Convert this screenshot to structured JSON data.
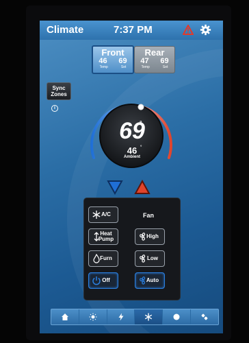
{
  "header": {
    "title": "Climate",
    "time": "7:37 PM"
  },
  "zones": [
    {
      "name": "Front",
      "temp": "46",
      "set": "69",
      "temp_label": "Temp",
      "set_label": "Set"
    },
    {
      "name": "Rear",
      "temp": "47",
      "set": "69",
      "temp_label": "Temp",
      "set_label": "Set"
    }
  ],
  "sync": {
    "line1": "Sync",
    "line2": "Zones"
  },
  "dial": {
    "setpoint": "69",
    "ambient": "46",
    "ambient_label": "Ambient"
  },
  "controls": {
    "ac": "A/C",
    "heat_pump": "Heat Pump",
    "furn": "Furn",
    "off": "Off",
    "fan_title": "Fan",
    "high": "High",
    "low": "Low",
    "auto": "Auto"
  },
  "nav": [
    "home-icon",
    "lights-icon",
    "power-icon",
    "climate-icon",
    "sound-icon",
    "tools-icon"
  ],
  "colors": {
    "accent": "#2a7fe0",
    "cool": "#1f6fd6",
    "heat": "#e0442c",
    "alert": "#e03a2c"
  }
}
